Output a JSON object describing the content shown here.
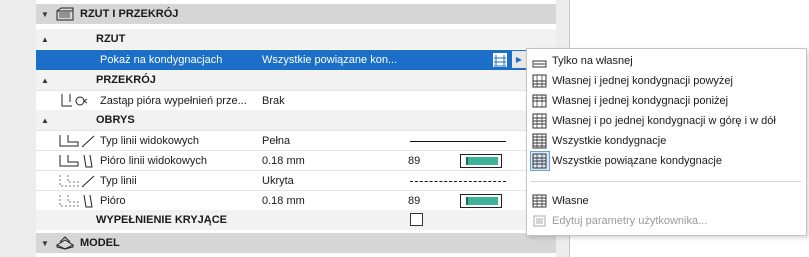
{
  "sections": {
    "rzut_przekroj": "RZUT I PRZEKRÓJ",
    "model": "MODEL"
  },
  "groups": {
    "rzut": "RZUT",
    "przekroj": "PRZEKRÓJ",
    "obrys": "OBRYS",
    "wypelnienie": "WYPEŁNIENIE KRYJĄCE"
  },
  "rows": {
    "pokaz": {
      "name": "Pokaż na kondygnacjach",
      "value": "Wszystkie powiązane kon..."
    },
    "zastap": {
      "name": "Zastąp pióra wypełnień prze...",
      "value": "Brak"
    },
    "typ_linii_widokowych": {
      "name": "Typ linii widokowych",
      "value": "Pełna"
    },
    "pioro_linii_widokowych": {
      "name": "Pióro linii widokowych",
      "value": "0.18 mm",
      "pen": "89"
    },
    "typ_linii": {
      "name": "Typ linii",
      "value": "Ukryta"
    },
    "pioro": {
      "name": "Pióro",
      "value": "0.18 mm",
      "pen": "89"
    }
  },
  "menu": {
    "items": [
      {
        "label": "Tylko na własnej",
        "icon": "story-own-icon"
      },
      {
        "label": "Własnej i jednej kondygnacji powyżej",
        "icon": "story-up-icon"
      },
      {
        "label": "Własnej i jednej kondygnacji poniżej",
        "icon": "story-down-icon"
      },
      {
        "label": "Własnej i po jednej kondygnacji w górę i w dół",
        "icon": "story-updown-icon"
      },
      {
        "label": "Wszystkie kondygnacje",
        "icon": "story-all-icon"
      },
      {
        "label": "Wszystkie powiązane kondygnacje",
        "icon": "story-related-icon"
      }
    ],
    "wlasne": "Własne",
    "edytuj": "Edytuj parametry użytkownika..."
  },
  "colors": {
    "selection": "#1b6fc8",
    "pen_swatch": "#3fb39a",
    "section_header": "#d6d6d6"
  }
}
